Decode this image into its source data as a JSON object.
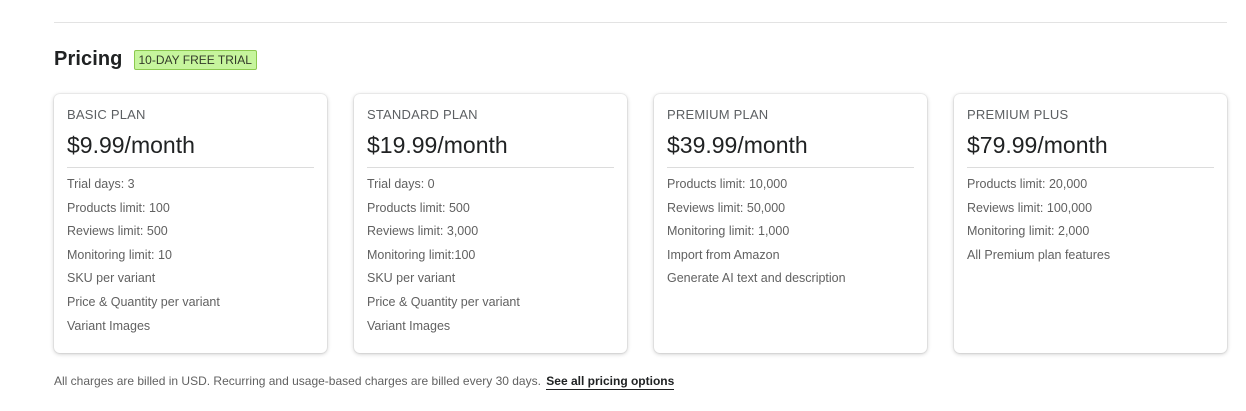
{
  "pricing": {
    "title": "Pricing",
    "badge": "10-DAY FREE TRIAL"
  },
  "plans": [
    {
      "name": "BASIC PLAN",
      "price": "$9.99/month",
      "features": [
        "Trial days: 3",
        "Products limit: 100",
        "Reviews limit: 500",
        "Monitoring limit: 10",
        "SKU per variant",
        "Price & Quantity per variant",
        "Variant Images"
      ]
    },
    {
      "name": "STANDARD PLAN",
      "price": "$19.99/month",
      "features": [
        "Trial days: 0",
        "Products limit: 500",
        "Reviews limit: 3,000",
        "Monitoring limit:100",
        "SKU per variant",
        "Price & Quantity per variant",
        "Variant Images"
      ]
    },
    {
      "name": "PREMIUM PLAN",
      "price": "$39.99/month",
      "features": [
        "Products limit: 10,000",
        "Reviews limit: 50,000",
        "Monitoring limit: 1,000",
        "Import from Amazon",
        "Generate AI text and description"
      ]
    },
    {
      "name": "PREMIUM PLUS",
      "price": "$79.99/month",
      "features": [
        "Products limit: 20,000",
        "Reviews limit: 100,000",
        "Monitoring limit: 2,000",
        "All Premium plan features"
      ]
    }
  ],
  "footer": {
    "note": "All charges are billed in USD. Recurring and usage-based charges are billed every 30 days.",
    "link_label": "See all pricing options"
  },
  "colors": {
    "badge_background": "#c6f59d",
    "badge_border": "#8cc94f",
    "text_primary": "#202223",
    "text_secondary": "#616161"
  }
}
